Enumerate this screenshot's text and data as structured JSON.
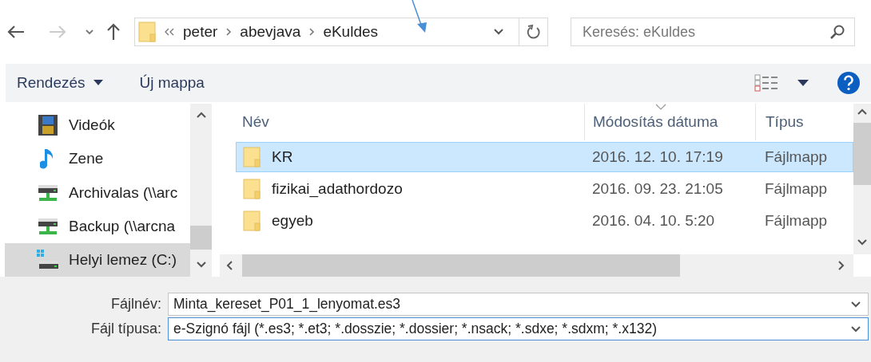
{
  "address": {
    "crumbs": [
      "peter",
      "abevjava",
      "eKuldes"
    ]
  },
  "search": {
    "placeholder": "Keresés: eKuldes"
  },
  "toolbar": {
    "buttons": [
      "Rendezés",
      "Új mappa"
    ]
  },
  "sidebar": {
    "items": [
      {
        "label": "Videók",
        "kind": "video",
        "selected": false
      },
      {
        "label": "Zene",
        "kind": "music",
        "selected": false
      },
      {
        "label": "Archivalas (\\\\arc",
        "kind": "network",
        "selected": false
      },
      {
        "label": "Backup (\\\\arcna",
        "kind": "network",
        "selected": false
      },
      {
        "label": "Helyi lemez (C:)",
        "kind": "disk",
        "selected": true
      }
    ]
  },
  "table": {
    "columns": [
      "Név",
      "Módosítás dátuma",
      "Típus"
    ],
    "rows": [
      {
        "name": "KR",
        "date": "2016. 12. 10. 17:19",
        "type": "Fájlmapp",
        "selected": true
      },
      {
        "name": "fizikai_adathordozo",
        "date": "2016. 09. 23. 21:05",
        "type": "Fájlmapp",
        "selected": false
      },
      {
        "name": "egyeb",
        "date": "2016. 04. 10. 5:20",
        "type": "Fájlmapp",
        "selected": false
      }
    ]
  },
  "filename": {
    "label": "Fájlnév:",
    "value": "Minta_kereset_P01_1_lenyomat.es3"
  },
  "filetype": {
    "label": "Fájl típusa:",
    "value": "e-Szignó fájl (*.es3; *.et3; *.dosszie; *.dossier; *.nsack; *.sdxe; *.sdxm; *.x132)"
  }
}
